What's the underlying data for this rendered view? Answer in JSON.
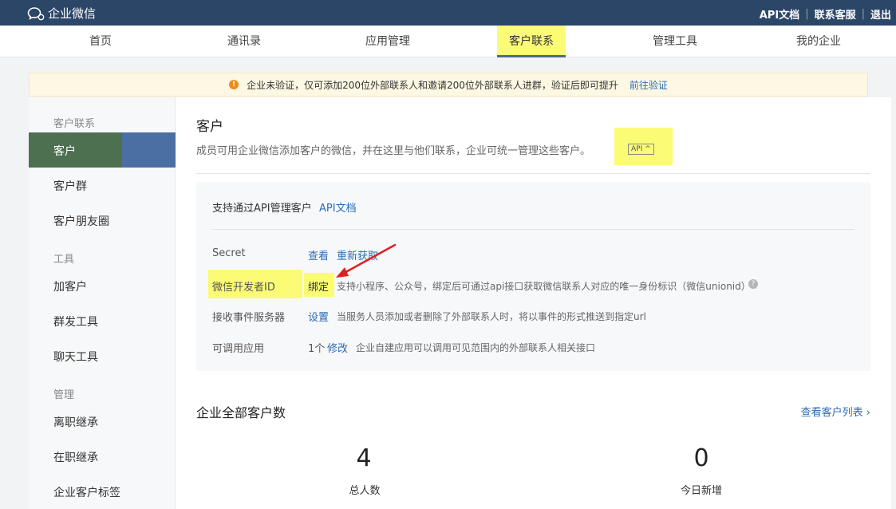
{
  "header": {
    "logo_text": "企业微信",
    "links": [
      {
        "label": "API文档"
      },
      {
        "label": "联系客服"
      },
      {
        "label": "退出"
      }
    ]
  },
  "nav": {
    "items": [
      "首页",
      "通讯录",
      "应用管理",
      "客户联系",
      "管理工具",
      "我的企业"
    ],
    "active": "客户联系"
  },
  "notice": {
    "text": "企业未验证，仅可添加200位外部联系人和邀请200位外部联系人进群，验证后即可提升",
    "link": "前往验证"
  },
  "sidebar": {
    "groups": [
      {
        "label": "客户联系",
        "items": [
          "客户",
          "客户群",
          "客户朋友圈"
        ]
      },
      {
        "label": "工具",
        "items": [
          "加客户",
          "群发工具",
          "聊天工具"
        ]
      },
      {
        "label": "管理",
        "items": [
          "离职继承",
          "在职继承",
          "企业客户标签"
        ]
      }
    ],
    "active": "客户"
  },
  "main": {
    "title": "客户",
    "description": "成员可用企业微信添加客户的微信，并在这里与他们联系，企业可统一管理这些客户。",
    "api_badge": "API ^",
    "api_box": {
      "title": "支持通过API管理客户",
      "doc_link": "API文档",
      "rows": [
        {
          "label": "Secret",
          "actions": [
            "查看",
            "重新获取"
          ],
          "text": ""
        },
        {
          "label": "微信开发者ID",
          "actions": [
            "绑定"
          ],
          "text": "支持小程序、公众号，绑定后可通过api接口获取微信联系人对应的唯一身份标识（微信unionid）"
        },
        {
          "label": "接收事件服务器",
          "actions": [
            "设置"
          ],
          "text": "当服务人员添加或者删除了外部联系人时，将以事件的形式推送到指定url"
        },
        {
          "label": "可调用应用",
          "count": "1个",
          "actions": [
            "修改"
          ],
          "text": "企业自建应用可以调用可见范围内的外部联系人相关接口"
        }
      ]
    },
    "stats": {
      "title": "企业全部客户数",
      "link": "查看客户列表 ›",
      "items": [
        {
          "value": "4",
          "label": "总人数"
        },
        {
          "value": "0",
          "label": "今日新增"
        }
      ]
    }
  },
  "colors": {
    "topbar": "#2c4668",
    "highlight": "#fbfb76",
    "link": "#2d6bb5",
    "annotation_arrow": "#e02020"
  }
}
